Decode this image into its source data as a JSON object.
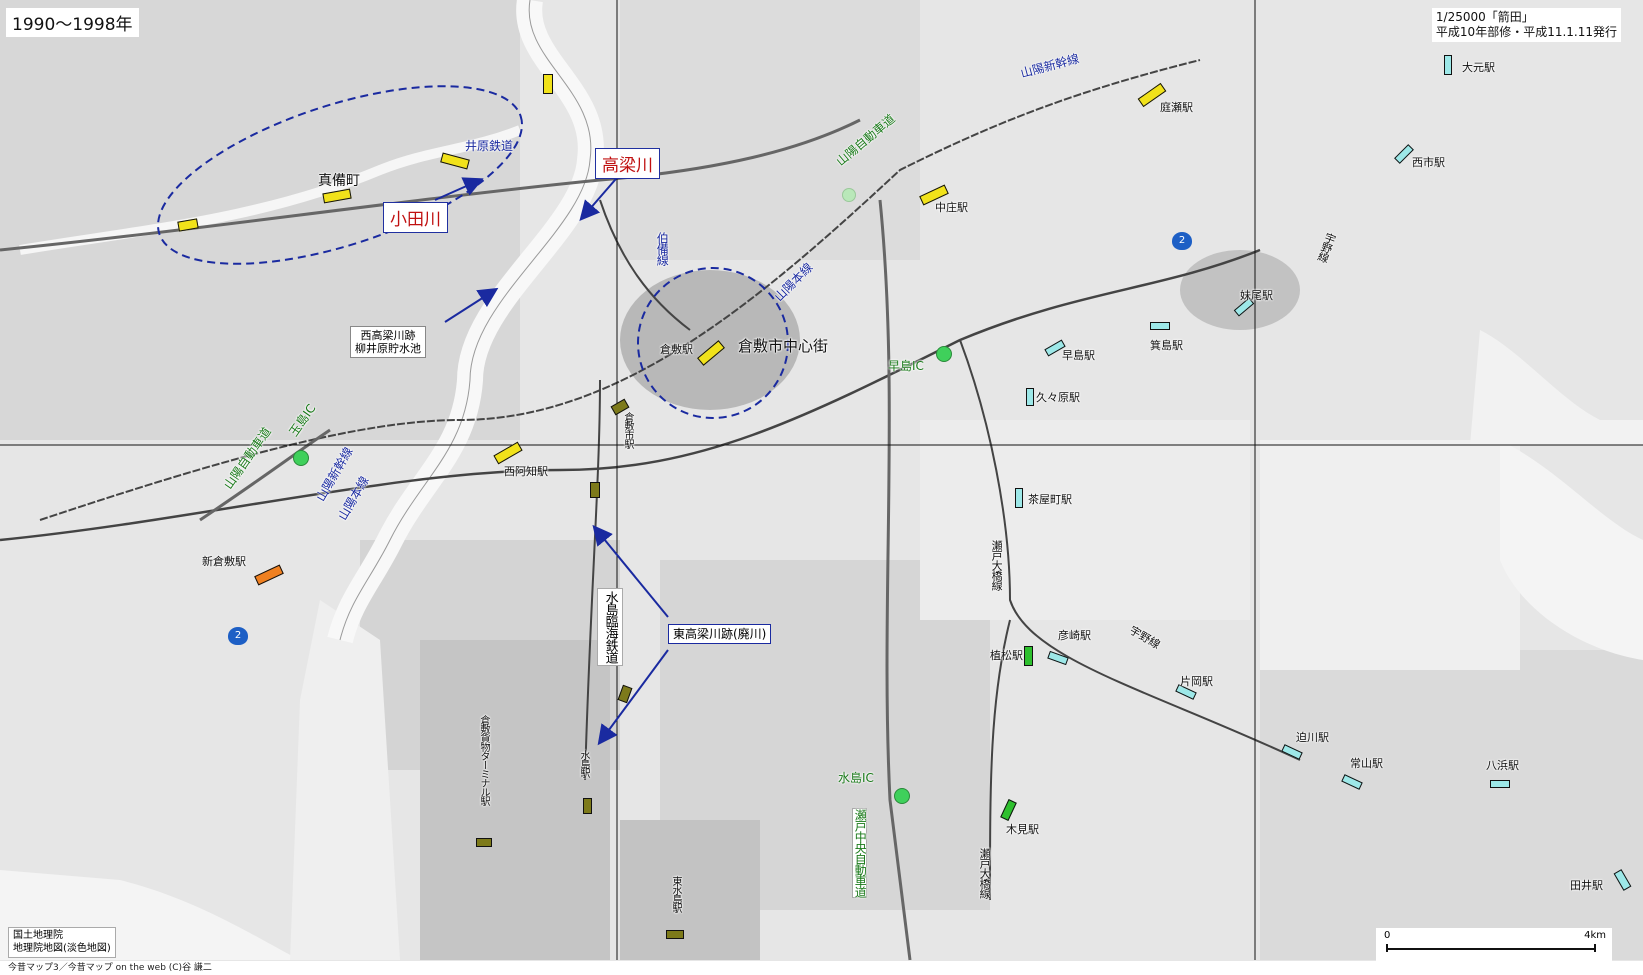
{
  "header": {
    "period": "1990〜1998年"
  },
  "source": {
    "line1": "1/25000「箭田」",
    "line2": "平成10年部修・平成11.1.11発行"
  },
  "credit": {
    "line1": "国土地理院",
    "line2": "地理院地図(淡色地図)"
  },
  "footer": {
    "text": "今昔マップ3／今昔マップ on the web (C)谷 謙二"
  },
  "scale": {
    "start": "0",
    "end": "4km"
  },
  "rivers": {
    "takahashi": "高梁川",
    "oda": "小田川"
  },
  "annotations": {
    "nishi_reservoir_line1": "西高梁川跡",
    "nishi_reservoir_line2": "柳井原貯水池",
    "higashi_river": "東高梁川跡(廃川)",
    "city_center": "倉敷市中心街"
  },
  "places": {
    "mabi": "真備町"
  },
  "lines": {
    "ibara": "井原鉄道",
    "sanyo_shinkansen_ne": "山陽新幹線",
    "sanyo_expressway_n": "山陽自動車道",
    "hakubi": "伯備線",
    "sanyo_main_c": "山陽本線",
    "sanyo_expressway_w": "山陽自動車道",
    "tamashima_ic": "玉島IC",
    "sanyo_shinkansen_w": "山陽新幹線",
    "sanyo_main_w": "山陽本線",
    "mizushima_rinkai": "水島臨海鉄道",
    "uno": "宇野線",
    "uno_s": "宇野線",
    "seto_ohashi_n": "瀬戸大橋線",
    "seto_ohashi_s": "瀬戸大橋線",
    "seto_chuo": "瀬戸中央自動車道"
  },
  "stations": {
    "niwase": "庭瀬駅",
    "nakasho": "中庄駅",
    "omoto": "大元駅",
    "nishiichi": "西市駅",
    "seno": "妹尾駅",
    "minoshima": "箕島駅",
    "hayashima": "早島駅",
    "kukuhara": "久々原駅",
    "kurashiki": "倉敷駅",
    "kurashiki_shi": "倉敷市駅",
    "nishiachi": "西阿知駅",
    "shinkurashiki": "新倉敷駅",
    "chayamachi": "茶屋町駅",
    "ueno": "植松駅",
    "hikosaki": "彦崎駅",
    "kataoka": "片岡駅",
    "sakogawa": "迫川駅",
    "tsuneyama": "常山駅",
    "yahama": "八浜駅",
    "kimi": "木見駅",
    "tai": "田井駅",
    "mizushima": "水島駅",
    "kurashiki_kamotsu": "倉敷貨物ターミナル駅",
    "higashi_mizushima": "東水島駅"
  },
  "interchanges": {
    "hayashima_ic": "早島IC",
    "mizushima_ic": "水島IC"
  },
  "routes": {
    "r2_ne": "2",
    "r2_w": "2"
  },
  "colors": {
    "shinkansen_station": "#f1e21a",
    "jr_station": "#9de8e8",
    "new_station": "#f08020",
    "mizushima_station": "#7d7a1a",
    "seto_ohashi_station": "#2ec02e",
    "arrow": "#1a2aa0",
    "river_label": "#c01010"
  }
}
